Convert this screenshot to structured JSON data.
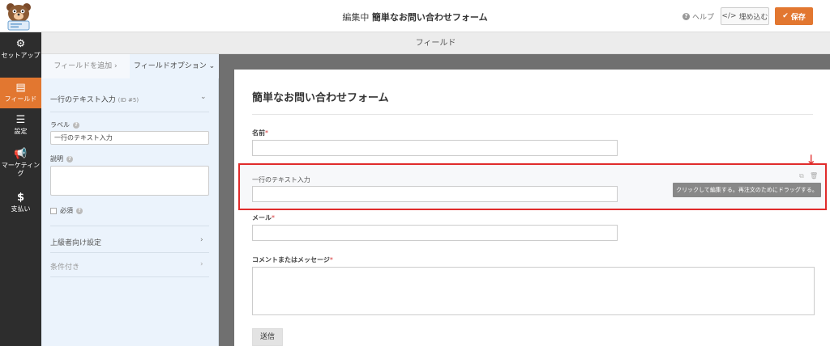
{
  "header": {
    "editing_label": "編集中",
    "form_name": "簡単なお問い合わせフォーム",
    "help_label": "ヘルプ",
    "embed_label": "埋め込む",
    "save_label": "保存"
  },
  "nav": {
    "items": [
      {
        "label": "セットアップ",
        "icon": "gear-icon",
        "active": false
      },
      {
        "label": "フィールド",
        "icon": "fields-icon",
        "active": true
      },
      {
        "label": "設定",
        "icon": "sliders-icon",
        "active": false
      },
      {
        "label": "マーケティング",
        "icon": "megaphone-icon",
        "active": false
      },
      {
        "label": "支払い",
        "icon": "dollar-icon",
        "active": false
      }
    ]
  },
  "subheader": {
    "title": "フィールド"
  },
  "panel": {
    "tabs": {
      "add_fields": "フィールドを追加",
      "field_options": "フィールドオプション"
    },
    "field_name": "一行のテキスト入力",
    "field_id": "(ID #5)",
    "label_caption": "ラベル",
    "label_value": "一行のテキスト入力",
    "description_caption": "説明",
    "required_caption": "必須",
    "advanced_caption": "上級者向け設定",
    "conditional_caption": "条件付き"
  },
  "form": {
    "title": "簡単なお問い合わせフォーム",
    "name_label": "名前",
    "text_label": "一行のテキスト入力",
    "email_label": "メール",
    "message_label": "コメントまたはメッセージ",
    "required_mark": "*",
    "tooltip": "クリックして編集する。再注文のためにドラッグする。",
    "submit_label": "送信"
  },
  "colors": {
    "accent": "#e27730",
    "highlight": "#e02b2b",
    "sidebar": "#2d2d2d"
  }
}
